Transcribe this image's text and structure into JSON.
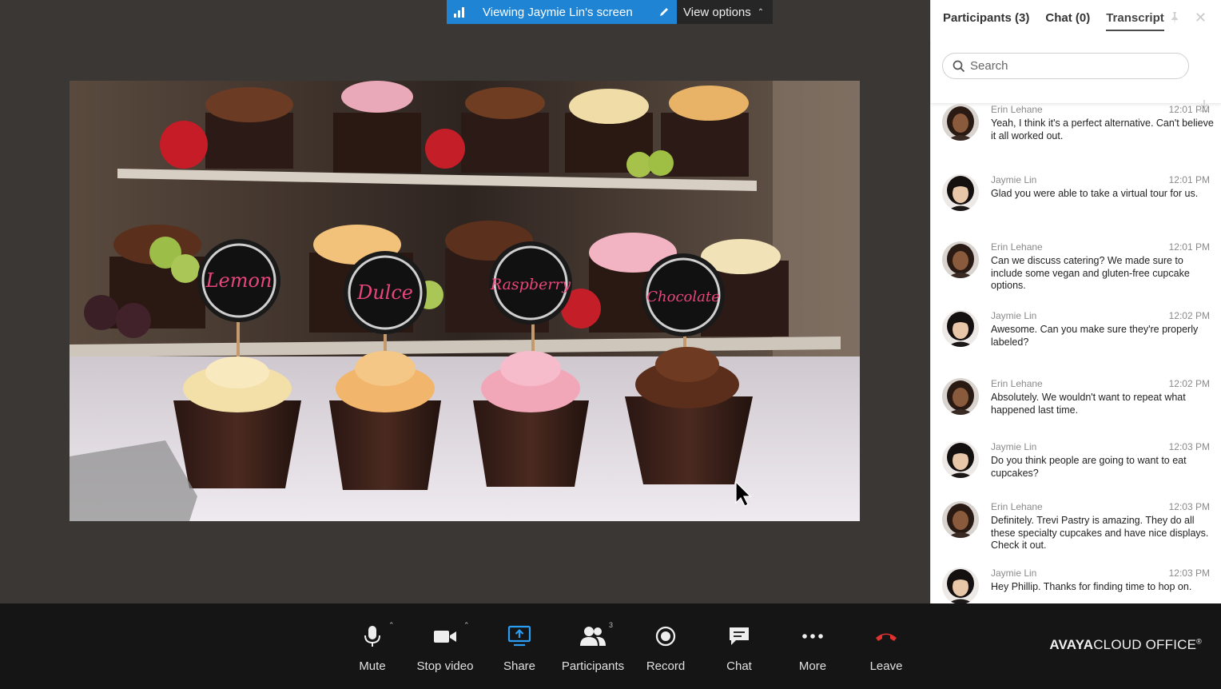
{
  "banner": {
    "viewing_text": "Viewing Jaymie Lin's screen",
    "options_label": "View options"
  },
  "shared_screen": {
    "cupcake_labels": [
      "Lemon",
      "Dulce",
      "Raspberry",
      "Chocolate"
    ]
  },
  "panel": {
    "tabs": [
      {
        "label": "Participants (3)"
      },
      {
        "label": "Chat (0)"
      },
      {
        "label": "Transcript",
        "active": true
      }
    ],
    "search_placeholder": "Search",
    "messages": [
      {
        "name": "Erin Lehane",
        "time": "12:01 PM",
        "text": "Yeah, I think it's a perfect alternative. Can't believe it all worked out."
      },
      {
        "name": "Jaymie Lin",
        "time": "12:01 PM",
        "text": "Glad you were able to take a virtual tour for us."
      },
      {
        "name": "Erin Lehane",
        "time": "12:01 PM",
        "text": "Can we discuss catering? We made sure to include some vegan and gluten-free cupcake options."
      },
      {
        "name": "Jaymie Lin",
        "time": "12:02 PM",
        "text": "Awesome. Can you make sure they're properly labeled?"
      },
      {
        "name": "Erin Lehane",
        "time": "12:02 PM",
        "text": "Absolutely. We wouldn't want to repeat what happened last time."
      },
      {
        "name": "Jaymie Lin",
        "time": "12:03 PM",
        "text": "Do you think people are going to want to eat cupcakes?"
      },
      {
        "name": "Erin Lehane",
        "time": "12:03 PM",
        "text": "Definitely. Trevi Pastry is amazing. They do all these specialty cupcakes and have nice displays. Check it out."
      },
      {
        "name": "Jaymie Lin",
        "time": "12:03 PM",
        "text": "Hey Phillip. Thanks for finding time to hop on."
      }
    ]
  },
  "toolbar": {
    "buttons": [
      {
        "label": "Mute",
        "icon": "microphone-icon"
      },
      {
        "label": "Stop video",
        "icon": "video-camera-icon"
      },
      {
        "label": "Share",
        "icon": "share-screen-icon",
        "color": "#2a9df4"
      },
      {
        "label": "Participants",
        "icon": "participants-icon",
        "badge": "3"
      },
      {
        "label": "Record",
        "icon": "record-icon"
      },
      {
        "label": "Chat",
        "icon": "chat-bubble-icon"
      },
      {
        "label": "More",
        "icon": "more-dots-icon"
      },
      {
        "label": "Leave",
        "icon": "hang-up-icon",
        "color": "#e0322e"
      }
    ],
    "brand_bold": "AVAYA",
    "brand_rest": "CLOUD OFFICE",
    "brand_mark": "®"
  }
}
